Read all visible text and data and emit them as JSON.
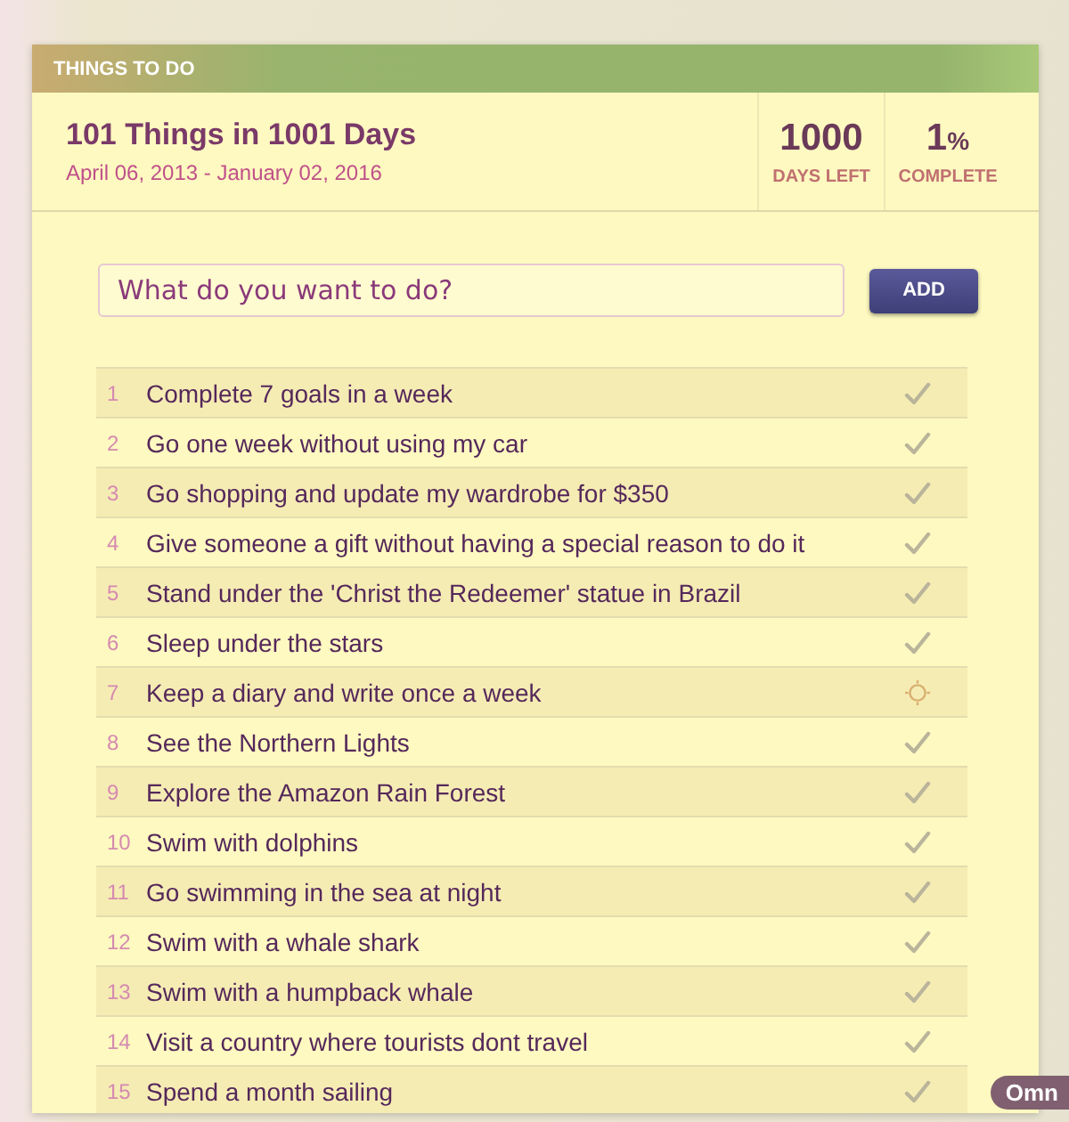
{
  "panel": {
    "title": "THINGS TO DO"
  },
  "list": {
    "name": "101 Things in 1001 Days",
    "dates": "April 06, 2013 - January 02, 2016"
  },
  "stats": [
    {
      "value": "1000",
      "label": "DAYS LEFT"
    },
    {
      "value": "1",
      "unit": "%",
      "label": "COMPLETE"
    }
  ],
  "new_item": {
    "placeholder": "What do you want to do?",
    "button": "ADD"
  },
  "items": [
    {
      "number": "1",
      "text": "Complete 7 goals in a week",
      "done": true
    },
    {
      "number": "2",
      "text": "Go one week without using my car",
      "done": true
    },
    {
      "number": "3",
      "text": "Go shopping and update my wardrobe for $350",
      "done": true
    },
    {
      "number": "4",
      "text": "Give someone a gift without having a special reason to do it",
      "done": true
    },
    {
      "number": "5",
      "text": "Stand under the 'Christ the Redeemer' statue in Brazil",
      "done": true
    },
    {
      "number": "6",
      "text": "Sleep under the stars",
      "done": true
    },
    {
      "number": "7",
      "text": "Keep a diary and write once a week",
      "done": false
    },
    {
      "number": "8",
      "text": "See the Northern Lights",
      "done": true
    },
    {
      "number": "9",
      "text": "Explore the Amazon Rain Forest",
      "done": true
    },
    {
      "number": "10",
      "text": "Swim with dolphins",
      "done": true
    },
    {
      "number": "11",
      "text": "Go swimming in the sea at night",
      "done": true
    },
    {
      "number": "12",
      "text": "Swim with a whale shark",
      "done": true
    },
    {
      "number": "13",
      "text": "Swim with a humpback whale",
      "done": true
    },
    {
      "number": "14",
      "text": "Visit a country where tourists dont travel",
      "done": true
    },
    {
      "number": "15",
      "text": "Spend a month sailing",
      "done": true
    }
  ],
  "corner_badge": "Omn"
}
